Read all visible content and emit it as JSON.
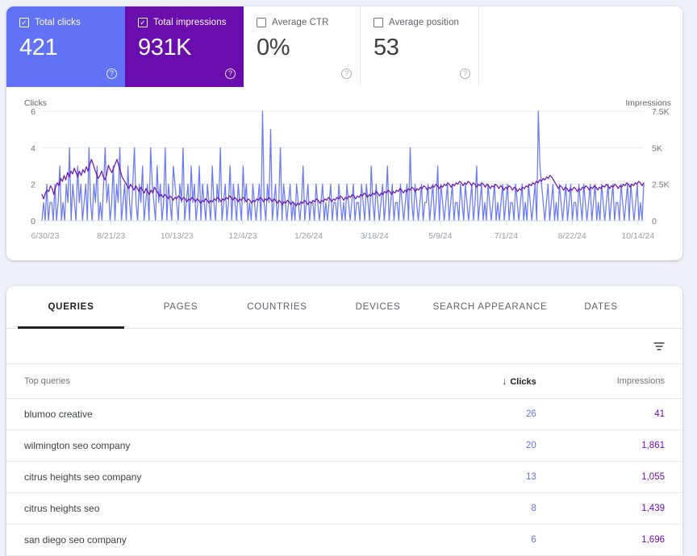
{
  "metrics": [
    {
      "label": "Total clicks",
      "value": "421",
      "checked": true,
      "checkmark": "✓",
      "help": "?",
      "style": "clicks"
    },
    {
      "label": "Total impressions",
      "value": "931K",
      "checked": true,
      "checkmark": "✓",
      "help": "?",
      "style": "impressions"
    },
    {
      "label": "Average CTR",
      "value": "0%",
      "checked": false,
      "checkmark": "",
      "help": "?",
      "style": "ctr"
    },
    {
      "label": "Average position",
      "value": "53",
      "checked": false,
      "checkmark": "",
      "help": "?",
      "style": "position"
    }
  ],
  "chart_data": {
    "type": "line",
    "title": "",
    "left_axis_label": "Clicks",
    "right_axis_label": "Impressions",
    "grid": true,
    "legend_position": "none",
    "yticks_left": [
      "0",
      "2",
      "4",
      "6"
    ],
    "yticks_right": [
      "0",
      "2.5K",
      "5K",
      "7.5K"
    ],
    "ylim_left": [
      0,
      6
    ],
    "ylim_right": [
      0,
      7500
    ],
    "xtick_labels": [
      "6/30/23",
      "8/21/23",
      "10/13/23",
      "12/4/23",
      "1/26/24",
      "3/18/24",
      "5/9/24",
      "7/1/24",
      "8/22/24",
      "10/14/24"
    ],
    "series": [
      {
        "name": "Clicks",
        "color": "#6173f4",
        "axis": "left",
        "values": [
          0,
          1,
          0,
          2,
          0,
          1,
          1,
          0,
          2,
          0,
          1,
          3,
          0,
          1,
          0,
          2,
          1,
          4,
          0,
          2,
          1,
          0,
          3,
          1,
          2,
          0,
          1,
          2,
          0,
          4,
          1,
          0,
          2,
          1,
          3,
          0,
          1,
          0,
          2,
          4,
          1,
          2,
          0,
          1,
          3,
          0,
          2,
          1,
          4,
          0,
          1,
          2,
          0,
          3,
          1,
          0,
          2,
          4,
          1,
          0,
          2,
          1,
          3,
          0,
          1,
          2,
          0,
          4,
          2,
          1,
          0,
          3,
          1,
          2,
          0,
          1,
          4,
          0,
          2,
          1,
          0,
          3,
          2,
          1,
          0,
          2,
          1,
          4,
          0,
          1,
          2,
          0,
          3,
          1,
          2,
          0,
          1,
          3,
          0,
          2,
          1,
          0,
          2,
          1,
          0,
          3,
          1,
          0,
          2,
          1,
          4,
          0,
          1,
          2,
          0,
          1,
          3,
          0,
          2,
          1,
          0,
          2,
          1,
          0,
          3,
          1,
          2,
          0,
          1,
          0,
          2,
          1,
          0,
          1,
          2,
          0,
          6,
          1,
          0,
          2,
          1,
          5,
          0,
          1,
          2,
          0,
          1,
          4,
          0,
          2,
          1,
          0,
          1,
          2,
          0,
          1,
          0,
          2,
          1,
          0,
          1,
          3,
          0,
          1,
          2,
          0,
          1,
          1,
          0,
          2,
          1,
          0,
          1,
          2,
          0,
          1,
          0,
          1,
          2,
          0,
          1,
          1,
          0,
          2,
          1,
          0,
          1,
          0,
          2,
          1,
          0,
          1,
          2,
          0,
          1,
          1,
          0,
          2,
          1,
          0,
          2,
          1,
          0,
          3,
          1,
          0,
          2,
          1,
          0,
          1,
          2,
          0,
          1,
          3,
          0,
          1,
          2,
          0,
          1,
          1,
          0,
          2,
          1,
          0,
          1,
          2,
          0,
          4,
          1,
          0,
          2,
          1,
          0,
          1,
          2,
          0,
          1,
          1,
          2,
          0,
          1,
          2,
          0,
          1,
          3,
          0,
          2,
          1,
          0,
          1,
          2,
          0,
          1,
          2,
          0,
          1,
          1,
          0,
          2,
          1,
          0,
          2,
          1,
          0,
          1,
          2,
          0,
          1,
          3,
          0,
          1,
          2,
          0,
          1,
          0,
          2,
          1,
          0,
          1,
          2,
          0,
          1,
          0,
          1,
          2,
          0,
          1,
          2,
          0,
          1,
          1,
          0,
          2,
          1,
          0,
          1,
          2,
          0,
          1,
          0,
          2,
          1,
          0,
          1,
          2,
          0,
          6,
          3,
          2,
          1,
          0,
          1,
          2,
          0,
          1,
          2,
          0,
          1,
          0,
          2,
          1,
          0,
          1,
          2,
          0,
          1,
          2,
          0,
          1,
          1,
          0,
          2,
          1,
          0,
          2,
          1,
          0,
          1,
          2,
          0,
          1,
          2,
          0,
          1,
          0,
          2,
          1,
          0,
          1,
          2,
          0,
          1,
          2,
          0,
          1,
          1,
          0,
          2,
          1,
          0,
          1,
          2,
          0,
          2,
          1,
          0,
          1,
          2,
          0,
          1,
          0,
          2
        ]
      },
      {
        "name": "Impressions",
        "color": "#6a0dad",
        "axis": "right",
        "values": [
          1800,
          1500,
          1900,
          2100,
          2000,
          2400,
          2200,
          1800,
          2300,
          2600,
          2400,
          2900,
          2700,
          3100,
          2800,
          3300,
          3000,
          3400,
          3200,
          3600,
          3300,
          3000,
          3400,
          3100,
          3500,
          3300,
          3700,
          3400,
          3800,
          4200,
          3900,
          3500,
          3200,
          2900,
          3100,
          3400,
          3000,
          2800,
          3200,
          3800,
          3500,
          3300,
          3600,
          3900,
          4200,
          3800,
          3400,
          3000,
          2800,
          2600,
          2400,
          2200,
          2500,
          2300,
          2100,
          2400,
          2200,
          2000,
          2300,
          2100,
          1900,
          2200,
          2000,
          1800,
          2100,
          1900,
          2300,
          2100,
          1900,
          1700,
          1800,
          1600,
          1800,
          1700,
          1500,
          1700,
          1600,
          1400,
          1600,
          1500,
          1700,
          1600,
          1400,
          1600,
          1500,
          1300,
          1500,
          1400,
          1600,
          1500,
          1300,
          1500,
          1400,
          1200,
          1400,
          1300,
          1500,
          1400,
          1200,
          1400,
          1300,
          1500,
          1400,
          1600,
          1500,
          1300,
          1500,
          1400,
          1600,
          1500,
          1700,
          1600,
          1400,
          1600,
          1500,
          1300,
          1500,
          1400,
          1600,
          1500,
          1300,
          1500,
          1400,
          1200,
          1400,
          1300,
          1500,
          1400,
          1600,
          1500,
          1300,
          1500,
          1400,
          1600,
          1500,
          1300,
          1500,
          1400,
          1200,
          1400,
          1300,
          1100,
          1300,
          1200,
          1400,
          1300,
          1100,
          1300,
          1200,
          1000,
          1200,
          1100,
          1300,
          1200,
          1400,
          1300,
          1100,
          1300,
          1200,
          1400,
          1300,
          1500,
          1400,
          1200,
          1400,
          1300,
          1500,
          1400,
          1600,
          1500,
          1300,
          1500,
          1400,
          1600,
          1500,
          1700,
          1600,
          1400,
          1600,
          1500,
          1700,
          1600,
          1800,
          1700,
          1500,
          1700,
          1600,
          1800,
          1700,
          1900,
          1800,
          1600,
          1800,
          1700,
          1900,
          1800,
          2000,
          1900,
          1700,
          1900,
          1800,
          2000,
          1900,
          2100,
          2000,
          1800,
          2000,
          1900,
          2100,
          2000,
          2200,
          2100,
          1900,
          2100,
          2000,
          2200,
          2100,
          2300,
          2200,
          2000,
          2200,
          2100,
          2300,
          2200,
          2400,
          2300,
          2100,
          2300,
          2200,
          2400,
          2300,
          2500,
          2400,
          2200,
          2400,
          2300,
          2500,
          2400,
          2600,
          2500,
          2300,
          2500,
          2400,
          2600,
          2500,
          2700,
          2600,
          2400,
          2600,
          2500,
          2700,
          2600,
          2400,
          2600,
          2500,
          2300,
          2500,
          2400,
          2600,
          2500,
          2300,
          2500,
          2400,
          2200,
          2400,
          2300,
          2500,
          2400,
          2200,
          2400,
          2300,
          2100,
          2300,
          2200,
          2400,
          2300,
          2100,
          2300,
          2200,
          2000,
          2200,
          2100,
          2300,
          2200,
          2400,
          2300,
          2500,
          2400,
          2600,
          2500,
          2700,
          2600,
          2800,
          2700,
          2900,
          2800,
          3000,
          2900,
          3100,
          3000,
          2800,
          2600,
          2400,
          2200,
          2400,
          2300,
          2100,
          2300,
          2200,
          2000,
          2200,
          2100,
          2300,
          2200,
          2000,
          2200,
          2100,
          2300,
          2200,
          2400,
          2300,
          2100,
          2300,
          2200,
          2400,
          2300,
          2100,
          2300,
          2200,
          2400,
          2300,
          2500,
          2400,
          2200,
          2400,
          2300,
          2500,
          2400,
          2200,
          2400,
          2300,
          2500,
          2400,
          2600,
          2500,
          2300,
          2500,
          2400,
          2600,
          2500,
          2700,
          2600,
          2400,
          2600
        ]
      }
    ]
  },
  "tabs": [
    {
      "label": "QUERIES",
      "active": true
    },
    {
      "label": "PAGES",
      "active": false
    },
    {
      "label": "COUNTRIES",
      "active": false
    },
    {
      "label": "DEVICES",
      "active": false
    },
    {
      "label": "SEARCH APPEARANCE",
      "active": false
    },
    {
      "label": "DATES",
      "active": false
    }
  ],
  "table": {
    "filter_icon": "filter-icon",
    "sort_arrow": "↓",
    "headers": {
      "query": "Top queries",
      "clicks": "Clicks",
      "impressions": "Impressions"
    },
    "rows": [
      {
        "query": "blumoo creative",
        "clicks": "26",
        "impressions": "41"
      },
      {
        "query": "wilmington seo company",
        "clicks": "20",
        "impressions": "1,861"
      },
      {
        "query": "citrus heights seo company",
        "clicks": "13",
        "impressions": "1,055"
      },
      {
        "query": "citrus heights seo",
        "clicks": "8",
        "impressions": "1,439"
      },
      {
        "query": "san diego seo company",
        "clicks": "6",
        "impressions": "1,696"
      }
    ]
  },
  "colors": {
    "clicks": "#6173f4",
    "impressions": "#6a0dad",
    "page_background": "#eef1f8",
    "panel": "#ffffff",
    "active_tab": "#202124"
  }
}
